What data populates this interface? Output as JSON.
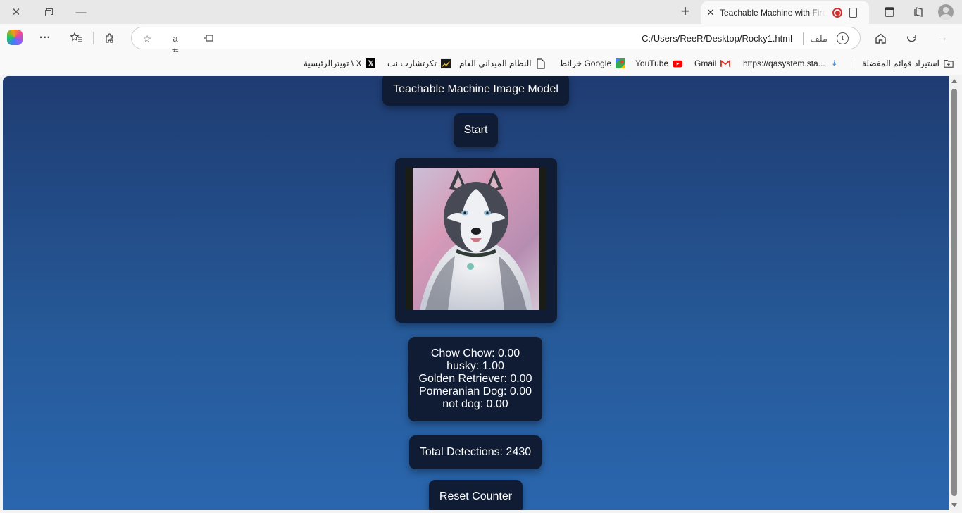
{
  "browser": {
    "tab_title": "Teachable Machine with Firebase",
    "address_url": "C:/Users/ReeR/Desktop/Rocky1.html",
    "address_scheme_label": "ملف",
    "bookmarks": [
      {
        "label": "استيراد قوائم المفضلة",
        "icon": "folder-import-icon"
      },
      {
        "label": "https://qasystem.sta...",
        "icon": "site-icon"
      },
      {
        "label": "Gmail",
        "icon": "gmail-icon"
      },
      {
        "label": "YouTube",
        "icon": "youtube-icon"
      },
      {
        "label": "خرائط Google",
        "icon": "maps-icon"
      },
      {
        "label": "النظام الميداني العام",
        "icon": "page-icon"
      },
      {
        "label": "تكرتشارت نت",
        "icon": "chart-icon"
      },
      {
        "label": "تويترالرئيسية \\ X",
        "icon": "x-icon"
      }
    ]
  },
  "page": {
    "title": "Teachable Machine Image Model",
    "start_label": "Start",
    "webcam_image": "husky-dog-photo",
    "predictions": [
      {
        "text": "Chow Chow: 0.00"
      },
      {
        "text": "husky: 1.00"
      },
      {
        "text": "Golden Retriever: 0.00"
      },
      {
        "text": "Pomeranian Dog: 0.00"
      },
      {
        "text": "not dog: 0.00"
      }
    ],
    "total_detections": "Total Detections: 2430",
    "reset_label": "Reset Counter"
  },
  "colors": {
    "card_bg": "#0f1c33",
    "bg_top": "#1f3c72",
    "bg_bottom": "#2a66ae"
  }
}
